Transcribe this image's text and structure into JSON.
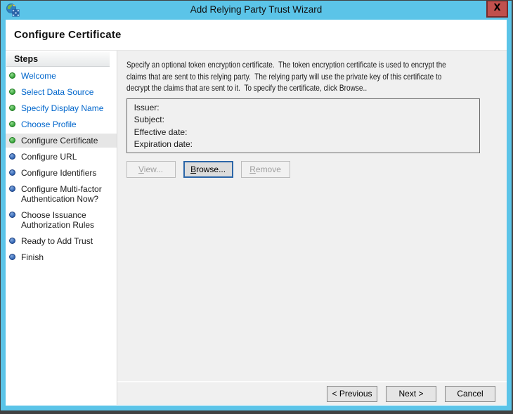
{
  "window": {
    "title": "Add Relying Party Trust Wizard",
    "close_glyph": "X"
  },
  "page": {
    "title": "Configure Certificate"
  },
  "sidebar": {
    "header": "Steps",
    "items": [
      {
        "label": "Welcome",
        "state": "done"
      },
      {
        "label": "Select Data Source",
        "state": "done"
      },
      {
        "label": "Specify Display Name",
        "state": "done"
      },
      {
        "label": "Choose Profile",
        "state": "done"
      },
      {
        "label": "Configure Certificate",
        "state": "current"
      },
      {
        "label": "Configure URL",
        "state": "upcoming"
      },
      {
        "label": "Configure Identifiers",
        "state": "upcoming"
      },
      {
        "label": "Configure Multi-factor Authentication Now?",
        "state": "upcoming"
      },
      {
        "label": "Choose Issuance Authorization Rules",
        "state": "upcoming"
      },
      {
        "label": "Ready to Add Trust",
        "state": "upcoming"
      },
      {
        "label": "Finish",
        "state": "upcoming"
      }
    ]
  },
  "main": {
    "description": "Specify an optional token encryption certificate.  The token encryption certificate is used to encrypt the\nclaims that are sent to this relying party.  The relying party will use the private key of this certificate to\ndecrypt the claims that are sent to it.  To specify the certificate, click Browse..",
    "certificate": {
      "fields": [
        {
          "label": "Issuer:",
          "value": ""
        },
        {
          "label": "Subject:",
          "value": ""
        },
        {
          "label": "Effective date:",
          "value": ""
        },
        {
          "label": "Expiration date:",
          "value": ""
        }
      ]
    },
    "buttons": {
      "view": {
        "accel": "V",
        "rest": "iew...",
        "enabled": false
      },
      "browse": {
        "accel": "B",
        "rest": "rowse...",
        "enabled": true
      },
      "remove": {
        "accel": "R",
        "rest": "emove",
        "enabled": false
      }
    }
  },
  "footer": {
    "previous": "< Previous",
    "next": "Next >",
    "cancel": "Cancel"
  },
  "colors": {
    "titlebar": "#5bc4e8",
    "close_button": "#c0504d",
    "content_background": "#f0f0f0",
    "link": "#0066cc",
    "done_dot": "#2f9e32",
    "upcoming_dot": "#2a5fb0"
  }
}
